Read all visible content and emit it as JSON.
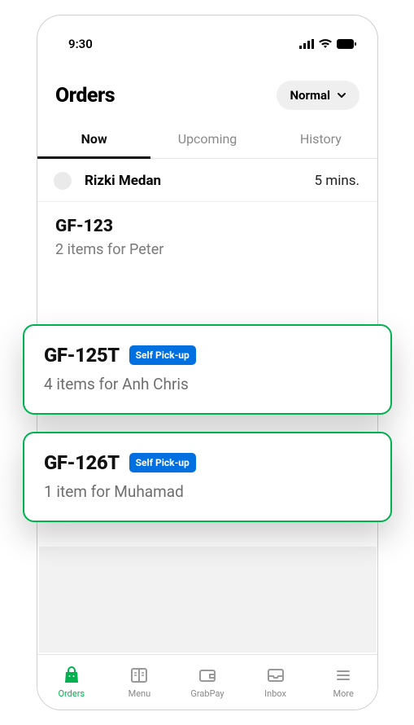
{
  "status": {
    "time": "9:30"
  },
  "header": {
    "title": "Orders",
    "filter_label": "Normal"
  },
  "tabs": [
    {
      "label": "Now",
      "active": true
    },
    {
      "label": "Upcoming",
      "active": false
    },
    {
      "label": "History",
      "active": false
    }
  ],
  "driver_section": {
    "name": "Rizki Medan",
    "eta": "5 mins."
  },
  "orders": [
    {
      "id": "GF-123",
      "summary": "2 items for Peter",
      "badge": null,
      "highlighted": false
    },
    {
      "id": "GF-125T",
      "summary": "4 items for Anh Chris",
      "badge": "Self Pick-up",
      "highlighted": true
    },
    {
      "id": "GF-126T",
      "summary": "1 item for Muhamad",
      "badge": "Self Pick-up",
      "highlighted": true
    }
  ],
  "navbar": [
    {
      "label": "Orders",
      "icon": "bag",
      "active": true
    },
    {
      "label": "Menu",
      "icon": "menu-book",
      "active": false
    },
    {
      "label": "GrabPay",
      "icon": "wallet",
      "active": false
    },
    {
      "label": "Inbox",
      "icon": "inbox",
      "active": false
    },
    {
      "label": "More",
      "icon": "more",
      "active": false
    }
  ],
  "colors": {
    "accent": "#00b14f",
    "badge": "#006fe0"
  }
}
